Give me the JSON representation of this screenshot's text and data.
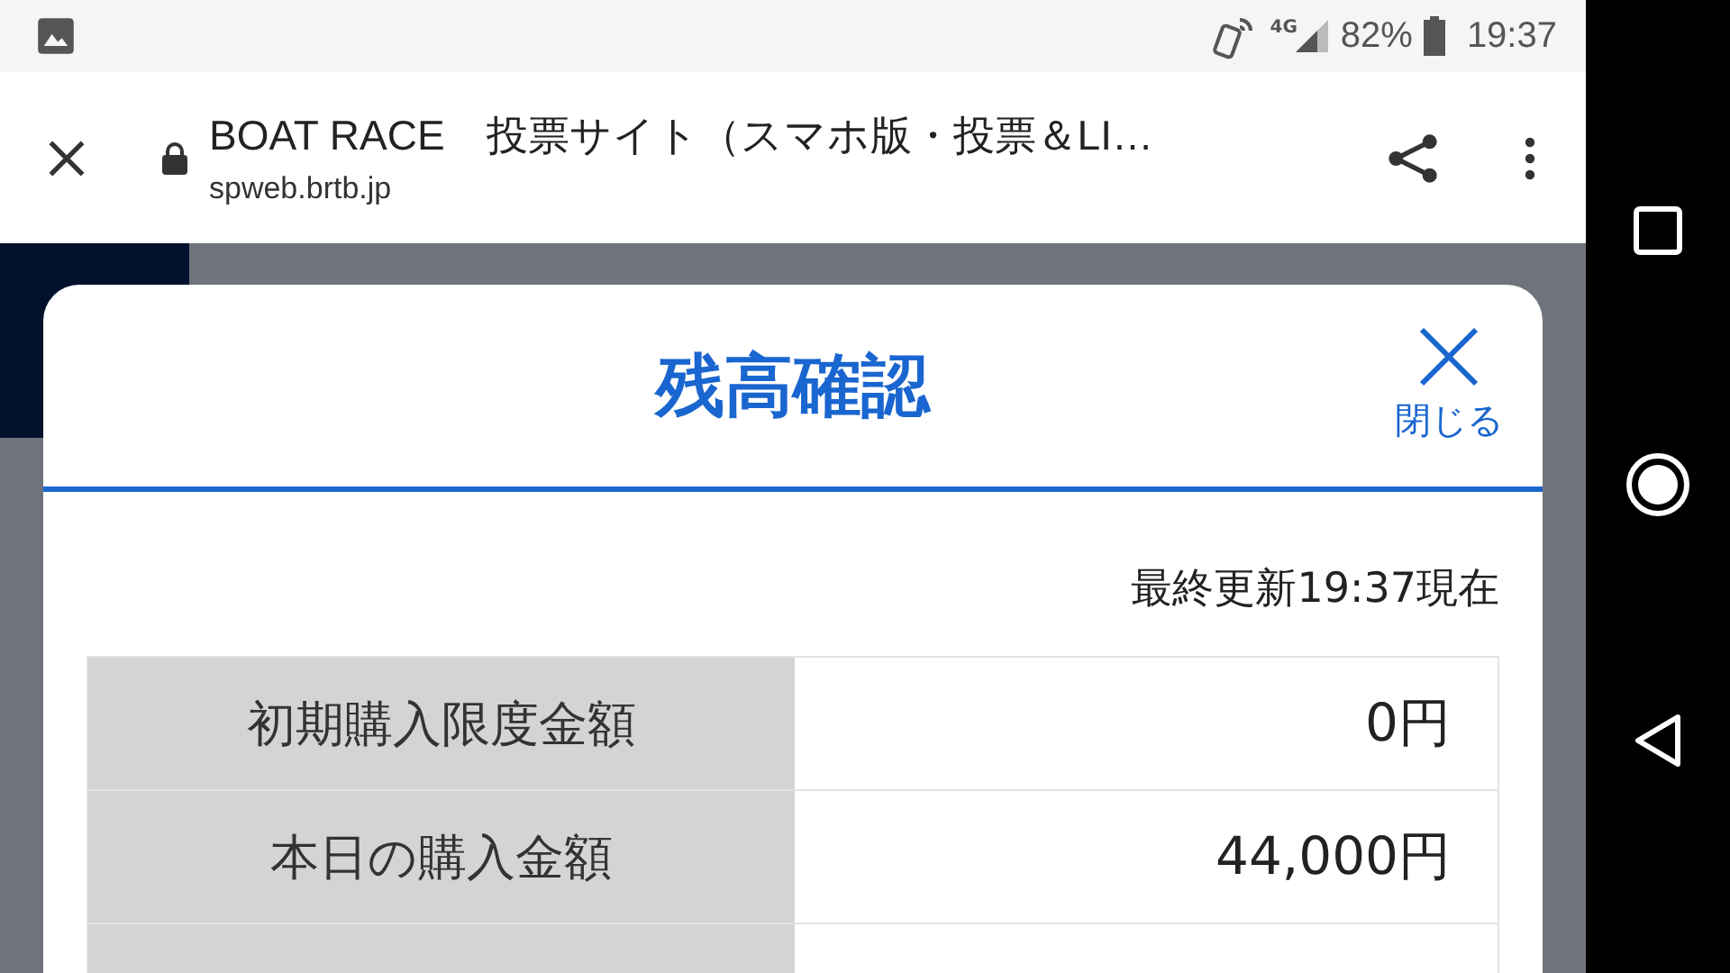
{
  "status_bar": {
    "network": "4G",
    "battery": "82%",
    "time": "19:37"
  },
  "browser_bar": {
    "title": "BOAT RACE　投票サイト（スマホ版・投票＆LI…",
    "url": "spweb.brtb.jp"
  },
  "dialog": {
    "title": "残高確認",
    "close_label": "閉じる",
    "updated": "最終更新19:37現在",
    "rows": [
      {
        "label": "初期購入限度金額",
        "value": "0円"
      },
      {
        "label": "本日の購入金額",
        "value": "44,000円"
      }
    ]
  }
}
